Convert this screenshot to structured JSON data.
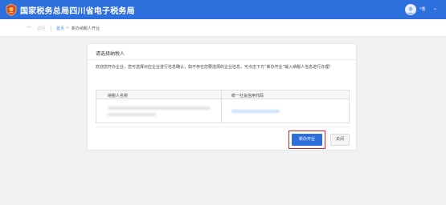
{
  "header": {
    "title": "国家税务总局四川省电子税务局",
    "user_name": "*香",
    "user_chevron": "⌄",
    "brand_color": "#2d6fdc"
  },
  "breadcrumb": {
    "back_icon": "←",
    "back_label": "返回",
    "home_label": "首页",
    "arrow": ">",
    "current_label": "新办纳税人开业"
  },
  "panel": {
    "title": "请选择纳税人",
    "description": "欢迎您开办企业，您可选择对应企业进行信息确认，如不存在您要选择的企业信息，可点击下方“新办开业”输入纳税人信息进行办理！",
    "table": {
      "columns": [
        "纳税人名称",
        "统一社会信用代码"
      ]
    },
    "buttons": {
      "new_label": "新办开业",
      "close_label": "关闭"
    }
  }
}
